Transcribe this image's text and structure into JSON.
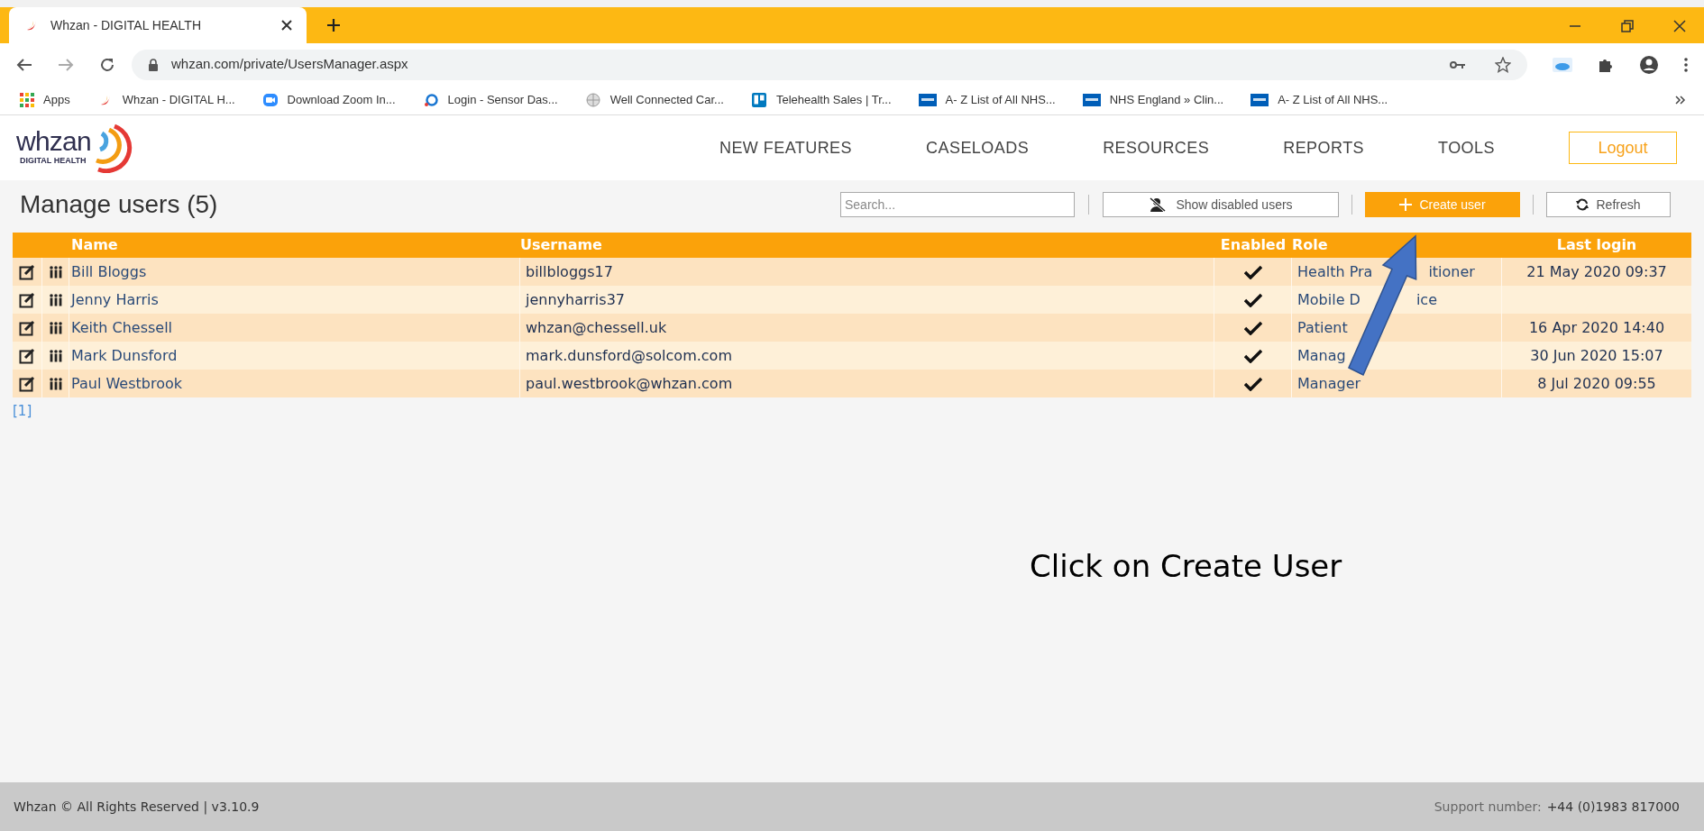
{
  "browser": {
    "tab": {
      "title": "Whzan - DIGITAL HEALTH"
    },
    "url": "whzan.com/private/UsersManager.aspx",
    "bookmarks": [
      {
        "kind": "apps",
        "label": "Apps"
      },
      {
        "kind": "whzan",
        "label": "Whzan - DIGITAL H..."
      },
      {
        "kind": "zoom",
        "label": "Download Zoom In..."
      },
      {
        "kind": "sensor",
        "label": "Login - Sensor Das..."
      },
      {
        "kind": "globe",
        "label": "Well Connected Car..."
      },
      {
        "kind": "trello",
        "label": "Telehealth Sales | Tr..."
      },
      {
        "kind": "nhs",
        "label": "A- Z List of All NHS..."
      },
      {
        "kind": "nhs",
        "label": "NHS England » Clin..."
      },
      {
        "kind": "nhs",
        "label": "A- Z List of All NHS..."
      }
    ]
  },
  "header": {
    "logo": "whzan",
    "logo_tagline": "DIGITAL HEALTH",
    "nav": [
      "NEW FEATURES",
      "CASELOADS",
      "RESOURCES",
      "REPORTS",
      "TOOLS"
    ],
    "logout": "Logout"
  },
  "page": {
    "title": "Manage users (5)",
    "search": {
      "placeholder": "Search..."
    },
    "show_disabled": "Show disabled users",
    "create": "Create user",
    "refresh": "Refresh"
  },
  "table": {
    "columns": [
      "Name",
      "Username",
      "Enabled",
      "Role",
      "Last login"
    ],
    "rows": [
      {
        "name": "Bill Bloggs",
        "username": "billbloggs17",
        "enabled": true,
        "role": [
          "Health Pra",
          "itioner"
        ],
        "last_login": "21 May 2020 09:37"
      },
      {
        "name": "Jenny Harris",
        "username": "jennyharris37",
        "enabled": true,
        "role": [
          "Mobile D",
          "ice"
        ]
      },
      {
        "name": "Keith Chessell",
        "username": "whzan@chessell.uk",
        "enabled": true,
        "role": [
          "Patient"
        ],
        "last_login": "16 Apr 2020 14:40"
      },
      {
        "name": "Mark Dunsford",
        "username": "mark.dunsford@solcom.com",
        "enabled": true,
        "role": [
          "Manag"
        ],
        "last_login": "30 Jun 2020 15:07"
      },
      {
        "name": "Paul Westbrook",
        "username": "paul.westbrook@whzan.com",
        "enabled": true,
        "role": [
          "Manager"
        ],
        "last_login": "8 Jul 2020 09:55"
      }
    ]
  },
  "pagination": "[1]",
  "annotation": "Click on Create User",
  "footer": {
    "copyright": "Whzan © All Rights Reserved | v3.10.9",
    "support_label": "Support number:",
    "support_number": "+44 (0)1983 817000"
  }
}
